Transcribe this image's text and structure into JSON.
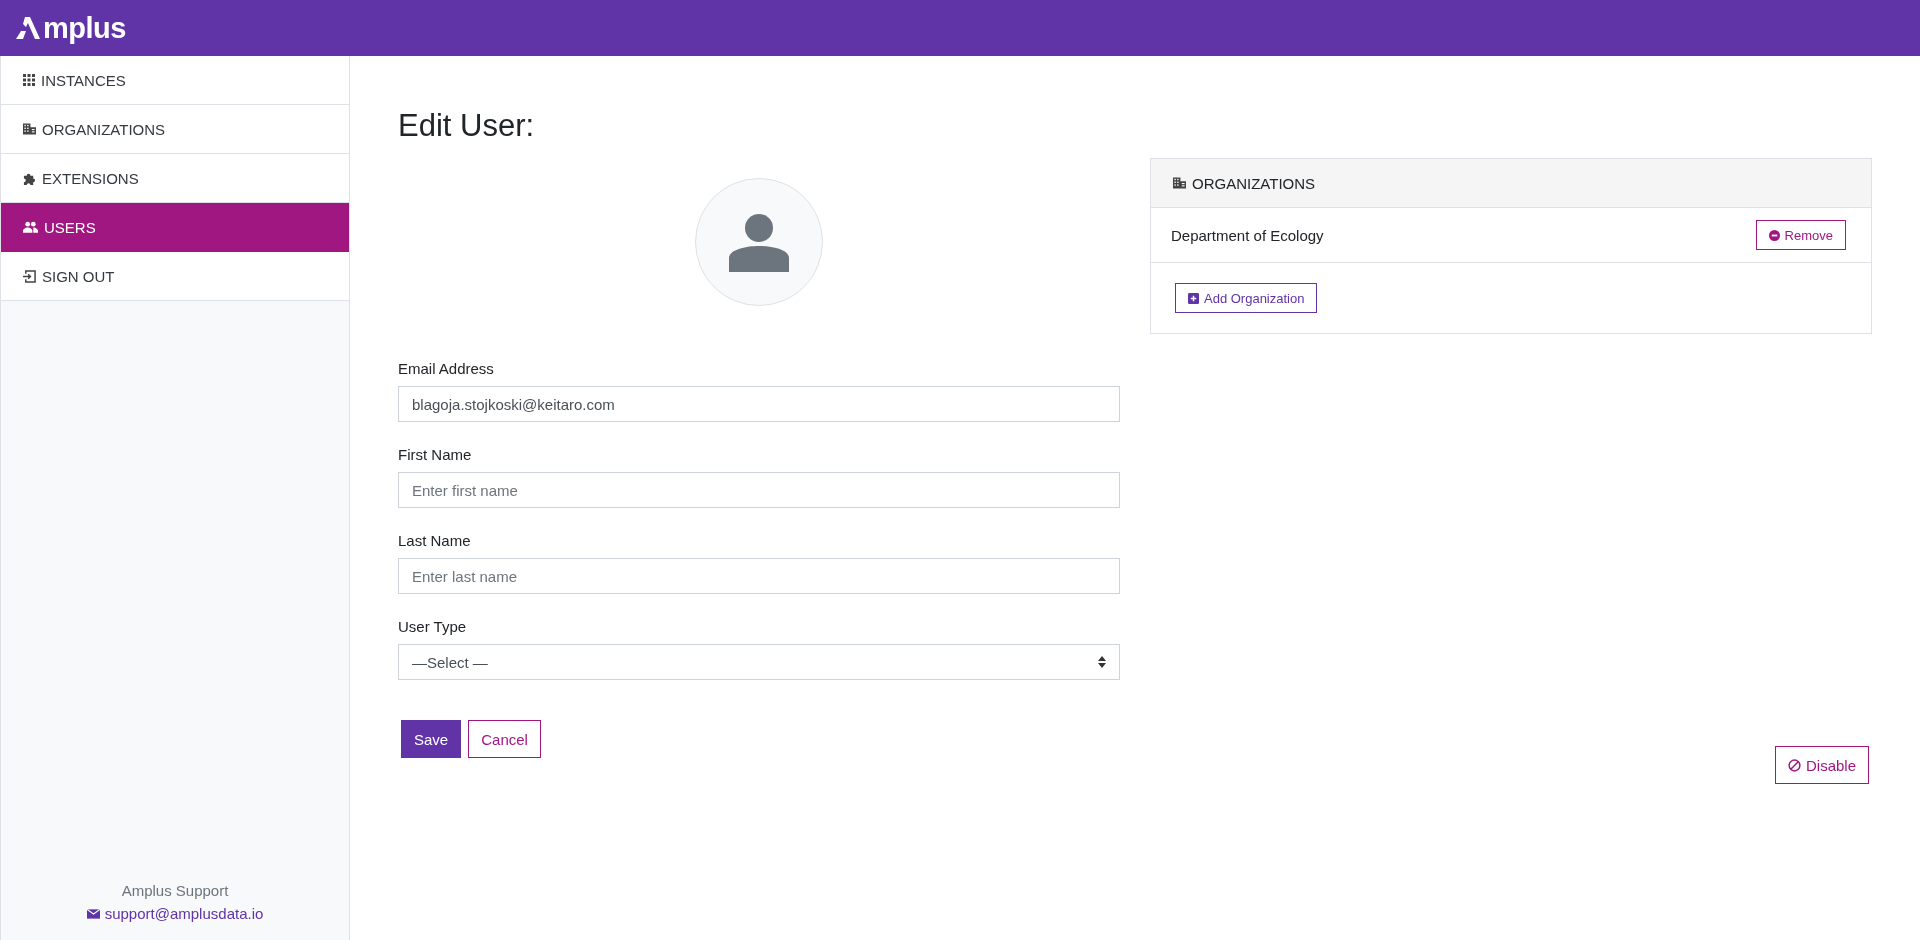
{
  "header": {
    "logo": "mplus"
  },
  "sidebar": {
    "items": [
      {
        "label": "INSTANCES",
        "selected": false
      },
      {
        "label": "ORGANIZATIONS",
        "selected": false
      },
      {
        "label": "EXTENSIONS",
        "selected": false
      },
      {
        "label": "USERS",
        "selected": true
      },
      {
        "label": "SIGN OUT",
        "selected": false
      }
    ],
    "support": {
      "title": "Amplus Support",
      "email": "support@amplusdata.io"
    }
  },
  "page": {
    "title": "Edit User:"
  },
  "form": {
    "fields": [
      {
        "kind": "input",
        "label": "Email Address",
        "value": "blagoja.stojkoski@keitaro.com"
      },
      {
        "kind": "input",
        "label": "First Name",
        "placeholder": "Enter first name"
      },
      {
        "kind": "input",
        "label": "Last Name",
        "placeholder": "Enter last name"
      },
      {
        "kind": "select",
        "label": "User Type",
        "value": "—Select —"
      }
    ],
    "save": "Save",
    "cancel": "Cancel",
    "disable": "Disable"
  },
  "organizations": {
    "title": "ORGANIZATIONS",
    "items": [
      {
        "name": "Department of Ecology",
        "action": "Remove"
      }
    ],
    "add": "Add Organization"
  }
}
